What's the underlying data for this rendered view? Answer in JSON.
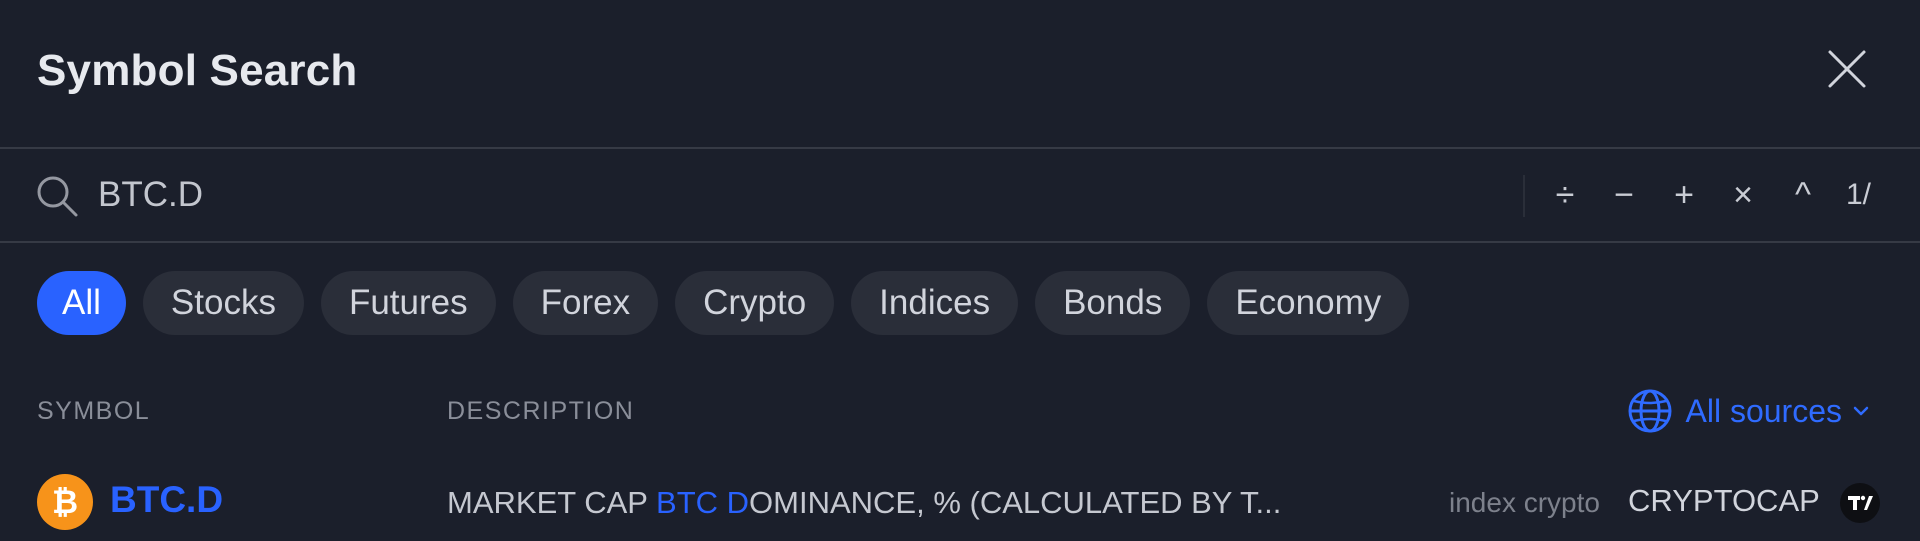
{
  "dialog": {
    "title": "Symbol Search"
  },
  "search": {
    "value": "BTC.D",
    "operators": [
      "÷",
      "−",
      "+",
      "×",
      "^"
    ],
    "count": "1/"
  },
  "filters": [
    {
      "label": "All",
      "active": true
    },
    {
      "label": "Stocks",
      "active": false
    },
    {
      "label": "Futures",
      "active": false
    },
    {
      "label": "Forex",
      "active": false
    },
    {
      "label": "Crypto",
      "active": false
    },
    {
      "label": "Indices",
      "active": false
    },
    {
      "label": "Bonds",
      "active": false
    },
    {
      "label": "Economy",
      "active": false
    }
  ],
  "columns": {
    "symbol": "SYMBOL",
    "description": "DESCRIPTION",
    "sources_label": "All sources"
  },
  "results": [
    {
      "coin_glyph": "₿",
      "symbol": "BTC.D",
      "description_prefix": "MARKET CAP ",
      "description_highlight": "BTC D",
      "description_suffix": "OMINANCE, % (CALCULATED BY T...",
      "type": "index crypto",
      "exchange": "CRYPTOCAP",
      "logo_text": "TV"
    }
  ],
  "colors": {
    "background": "#1b1f2b",
    "accent": "#2962ff",
    "chip_bg": "#2a2e39",
    "coin": "#f7931a"
  }
}
